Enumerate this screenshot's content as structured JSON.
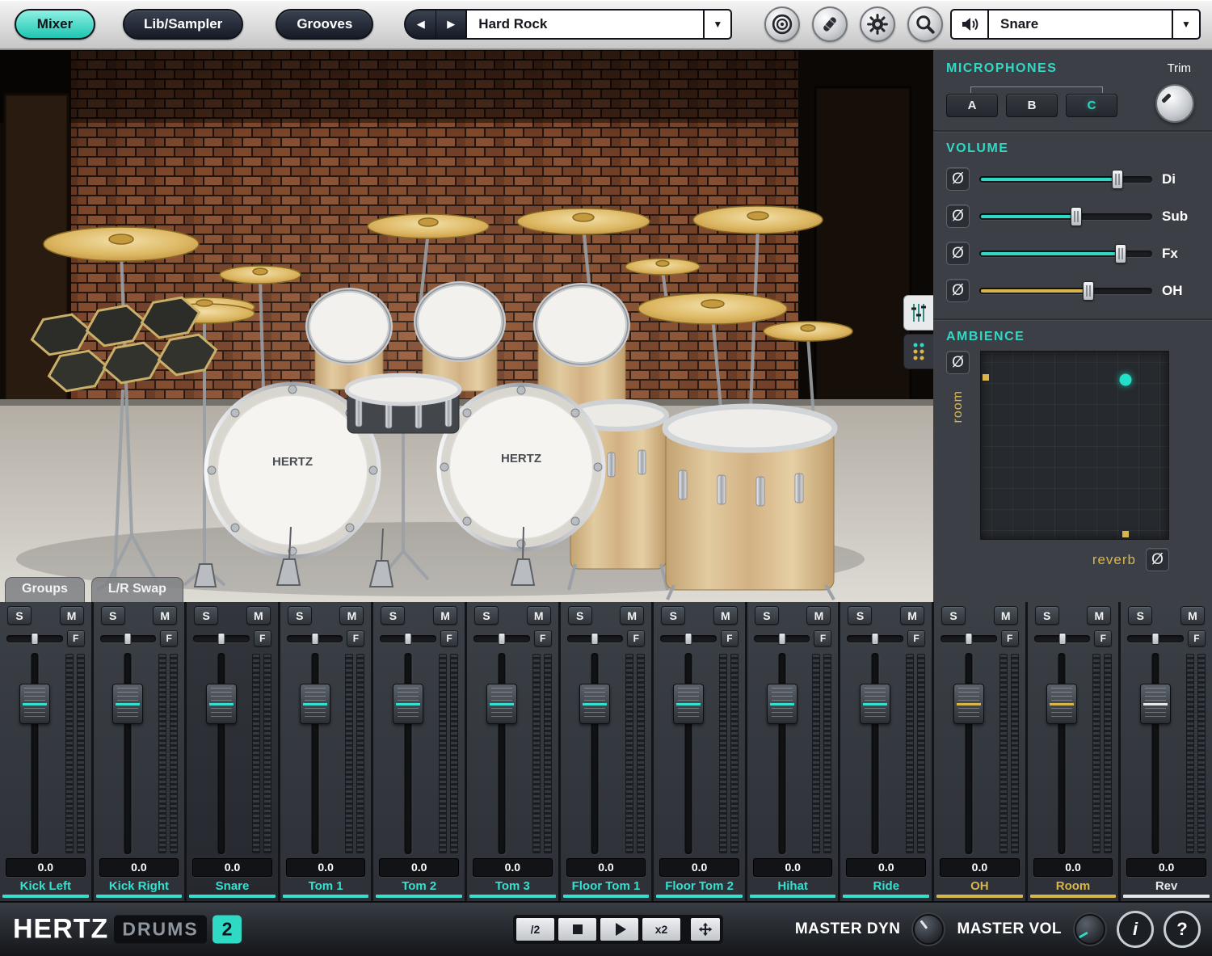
{
  "accent": {
    "teal": "#2fd9c4",
    "gold": "#d9b64a"
  },
  "icons": {
    "caret": "▼",
    "prev": "◀",
    "next": "▶"
  },
  "toolbar": {
    "mixer": "Mixer",
    "lib_sampler": "Lib/Sampler",
    "grooves": "Grooves",
    "preset": "Hard Rock",
    "output": "Snare"
  },
  "panel": {
    "microphones_title": "MICROPHONES",
    "trim_label": "Trim",
    "mics": [
      {
        "label": "A",
        "active": false
      },
      {
        "label": "B",
        "active": false
      },
      {
        "label": "C",
        "active": true
      }
    ],
    "volume_title": "VOLUME",
    "phase_symbol": "Ø",
    "sliders": [
      {
        "label": "Di",
        "value": 0.8,
        "color": "teal"
      },
      {
        "label": "Sub",
        "value": 0.56,
        "color": "teal"
      },
      {
        "label": "Fx",
        "value": 0.82,
        "color": "teal"
      },
      {
        "label": "OH",
        "value": 0.63,
        "color": "gold"
      }
    ],
    "ambience_title": "AMBIENCE",
    "room_label": "room",
    "reverb_label": "reverb",
    "pad": {
      "dot_x": 0.77,
      "dot_y": 0.15,
      "room_marker_y": 0.14,
      "reverb_marker_x": 0.77
    }
  },
  "scene": {
    "kick_logo": "HERTZ"
  },
  "scene_tabs": {
    "groups": "Groups",
    "lr_swap": "L/R Swap"
  },
  "mixer": {
    "solo": "S",
    "mute": "M",
    "fx": "F",
    "channels": [
      {
        "name": "Kick Left",
        "value": "0.0",
        "color": "teal"
      },
      {
        "name": "Kick Right",
        "value": "0.0",
        "color": "teal"
      },
      {
        "name": "Snare",
        "value": "0.0",
        "color": "teal",
        "selected": true
      },
      {
        "name": "Tom 1",
        "value": "0.0",
        "color": "teal"
      },
      {
        "name": "Tom 2",
        "value": "0.0",
        "color": "teal"
      },
      {
        "name": "Tom 3",
        "value": "0.0",
        "color": "teal"
      },
      {
        "name": "Floor Tom 1",
        "value": "0.0",
        "color": "teal"
      },
      {
        "name": "Floor Tom 2",
        "value": "0.0",
        "color": "teal"
      },
      {
        "name": "Hihat",
        "value": "0.0",
        "color": "teal"
      },
      {
        "name": "Ride",
        "value": "0.0",
        "color": "teal"
      },
      {
        "name": "OH",
        "value": "0.0",
        "color": "gold"
      },
      {
        "name": "Room",
        "value": "0.0",
        "color": "gold"
      },
      {
        "name": "Rev",
        "value": "0.0",
        "color": "white"
      }
    ]
  },
  "footer": {
    "logo_hertz": "HERTZ",
    "logo_drums": "DRUMS",
    "logo_version": "2",
    "half": "/2",
    "double": "x2",
    "master_dyn": "MASTER DYN",
    "master_vol": "MASTER VOL",
    "info": "i",
    "help": "?"
  }
}
